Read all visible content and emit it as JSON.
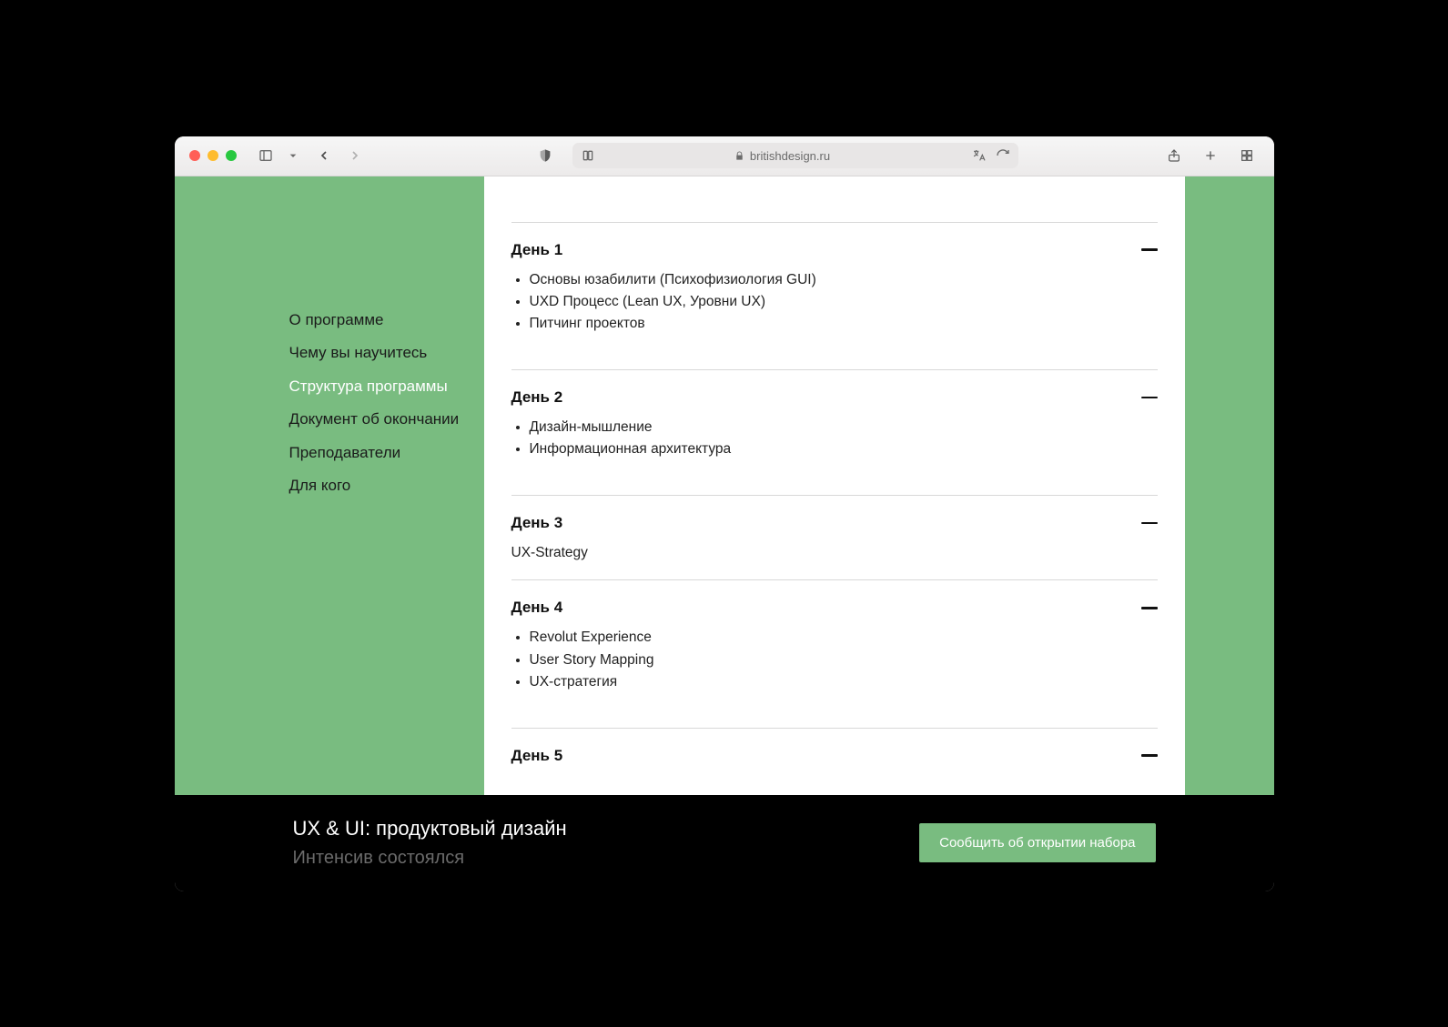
{
  "browser": {
    "url_domain": "britishdesign.ru"
  },
  "sidebar": {
    "items": [
      {
        "label": "О программе",
        "active": false
      },
      {
        "label": "Чему вы научитесь",
        "active": false
      },
      {
        "label": "Структура программы",
        "active": true
      },
      {
        "label": "Документ об окончании",
        "active": false
      },
      {
        "label": "Преподаватели",
        "active": false
      },
      {
        "label": "Для кого",
        "active": false
      }
    ]
  },
  "accordion": [
    {
      "title": "День 1",
      "items": [
        "Основы юзабилити (Психофизиология GUI)",
        "UXD Процесс (Lean UX, Уровни UX)",
        "Питчинг проектов"
      ]
    },
    {
      "title": "День 2",
      "items": [
        "Дизайн-мышление",
        "Информационная архитектура"
      ]
    },
    {
      "title": "День 3",
      "text": "UX-Strategy"
    },
    {
      "title": "День 4",
      "items": [
        "Revolut Experience",
        "User Story Mapping",
        "UX-стратегия"
      ]
    },
    {
      "title": "День 5"
    }
  ],
  "bottom_bar": {
    "title": "UX & UI: продуктовый дизайн",
    "subtitle": "Интенсив состоялся",
    "cta": "Сообщить об открытии набора"
  },
  "colors": {
    "accent_green": "#79bc80"
  }
}
